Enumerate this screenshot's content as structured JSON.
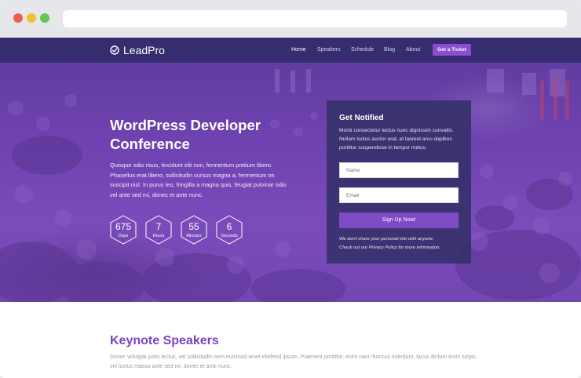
{
  "browser": {
    "window_controls": [
      "close",
      "minimize",
      "maximize"
    ]
  },
  "nav": {
    "logo_text": "LeadPro",
    "links": [
      {
        "label": "Home",
        "active": true
      },
      {
        "label": "Speakers"
      },
      {
        "label": "Schedule"
      },
      {
        "label": "Blog"
      },
      {
        "label": "About"
      }
    ],
    "cta_label": "Get a Ticket"
  },
  "hero": {
    "title_line1": "WordPress Developer",
    "title_line2": "Conference",
    "description": "Quisque odio risus, tincidunt elit non, fermentum pretium libero. Phasellus erat libero, sollicitudin cursus magna a, fermentum on suscipit nisl. In purus leo, fringilla a magna quis, feugiat pulvinar odio vel ante sed mi, donec et ante nunc.",
    "countdown": [
      {
        "value": "675",
        "label": "Days"
      },
      {
        "value": "7",
        "label": "Hours"
      },
      {
        "value": "55",
        "label": "Minutes"
      },
      {
        "value": "6",
        "label": "Seconds"
      }
    ]
  },
  "notify": {
    "title": "Get Notified",
    "description": "Morbi consectetur lectus nunc dignissim convallis. Nullam luctus auctor erat, et laoreet arcu dapibus porttitor suspendisse in tempor metus.",
    "name_placeholder": "Name",
    "email_placeholder": "Email",
    "submit_label": "Sign Up Now!",
    "privacy_line1": "We don't share your personal info with anyone.",
    "privacy_line2": "Check out our Privacy Policy for more information."
  },
  "keynote": {
    "title": "Keynote Speakers",
    "description": "Donec volutpat justo lectus, vel sollicitudin sem euismod amet eleifend ipsum. Praesent porttitor, enim nani rhoncus interdum, lacus dictum enim turpis, vel luctus massa ante sed mi, donec et ante nunc."
  },
  "colors": {
    "brand_purple": "#7e4bc5",
    "nav_bg": "#322c6c",
    "hero_overlay": "#6f42b1",
    "heading_purple": "#7a43c4"
  }
}
